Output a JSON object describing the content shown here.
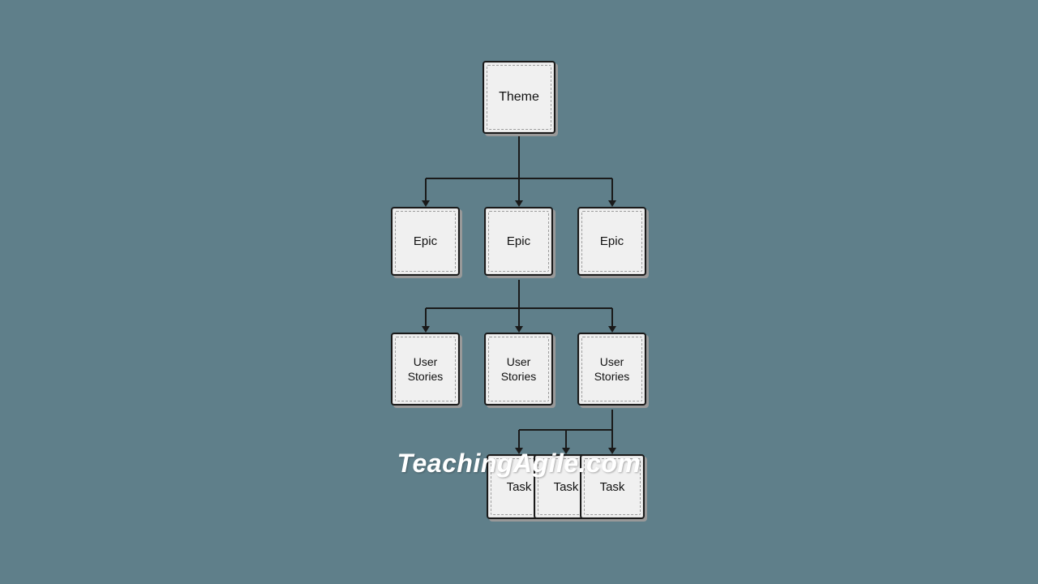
{
  "diagram": {
    "theme": {
      "label": "Theme"
    },
    "epics": [
      {
        "label": "Epic"
      },
      {
        "label": "Epic"
      },
      {
        "label": "Epic"
      }
    ],
    "stories": [
      {
        "label": "User\nStories"
      },
      {
        "label": "User\nStories"
      },
      {
        "label": "User\nStories"
      }
    ],
    "tasks": [
      {
        "label": "Task"
      },
      {
        "label": "Task"
      },
      {
        "label": "Task"
      }
    ]
  },
  "watermark": {
    "text": "TeachingAgile.com"
  },
  "colors": {
    "background": "#5f7f8a",
    "box_bg": "#f0f0f0",
    "box_border": "#1a1a1a",
    "connector": "#1a1a1a"
  }
}
